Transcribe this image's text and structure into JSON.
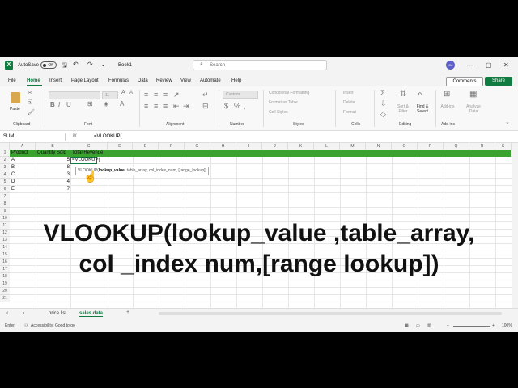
{
  "titlebar": {
    "app_icon": "X",
    "autosave_label": "AutoSave",
    "autosave_state": "Off",
    "book_name": "Book1",
    "search_placeholder": "Search",
    "avatar_initials": "KM"
  },
  "menu": {
    "items": [
      "File",
      "Home",
      "Insert",
      "Page Layout",
      "Formulas",
      "Data",
      "Review",
      "View",
      "Automate",
      "Help"
    ],
    "active": "Home",
    "comments_label": "Comments",
    "share_label": "Share"
  },
  "ribbon": {
    "groups": [
      "Clipboard",
      "Font",
      "Alignment",
      "Number",
      "Styles",
      "Cells",
      "Editing",
      "Add-ins"
    ],
    "paste_label": "Paste",
    "font_size": "11",
    "number_format": "Custom",
    "styles_items": [
      "Conditional Formatting",
      "Format as Table",
      "Cell Styles"
    ],
    "cells_items": [
      "Insert",
      "Delete",
      "Format"
    ],
    "editing_items": [
      "Sort & Filter",
      "Find & Select"
    ],
    "addins_items": [
      "Add-ins",
      "Analyze Data"
    ]
  },
  "formula_bar": {
    "name_box": "SUM",
    "fx": "fx",
    "formula": "=VLOOKUP("
  },
  "grid": {
    "columns": [
      "A",
      "B",
      "C",
      "D",
      "E",
      "F",
      "G",
      "H",
      "I",
      "J",
      "K",
      "L",
      "M",
      "N",
      "O",
      "P",
      "Q",
      "R",
      "S"
    ],
    "rows": [
      "1",
      "2",
      "3",
      "4",
      "5",
      "6",
      "7",
      "8",
      "9",
      "10",
      "11",
      "12",
      "13",
      "14",
      "15",
      "16",
      "17",
      "18",
      "19",
      "20",
      "21"
    ],
    "header_row": [
      "Product",
      "Quantity Sold",
      "Total Revenue"
    ],
    "data": [
      {
        "product": "A",
        "qty": "5",
        "rev": "=VLOOKUP("
      },
      {
        "product": "B",
        "qty": "8",
        "rev": ""
      },
      {
        "product": "C",
        "qty": "3",
        "rev": ""
      },
      {
        "product": "D",
        "qty": "4",
        "rev": ""
      },
      {
        "product": "E",
        "qty": "7",
        "rev": ""
      }
    ],
    "header_color": "#3aa22f"
  },
  "tooltip": {
    "fn": "VLOOKUP(",
    "arg1": "lookup_value",
    "rest": ", table_array, col_index_num, [range_lookup])"
  },
  "overlay": {
    "line1": "VLOOKUP(lookup_value ,table_array,",
    "line2": "col _index num,[range lookup])"
  },
  "sheets": {
    "tabs": [
      "price list",
      "sales data"
    ],
    "active": "sales data",
    "add_label": "+"
  },
  "status": {
    "mode": "Enter",
    "accessibility": "Accessibility: Good to go",
    "zoom": "100%"
  }
}
